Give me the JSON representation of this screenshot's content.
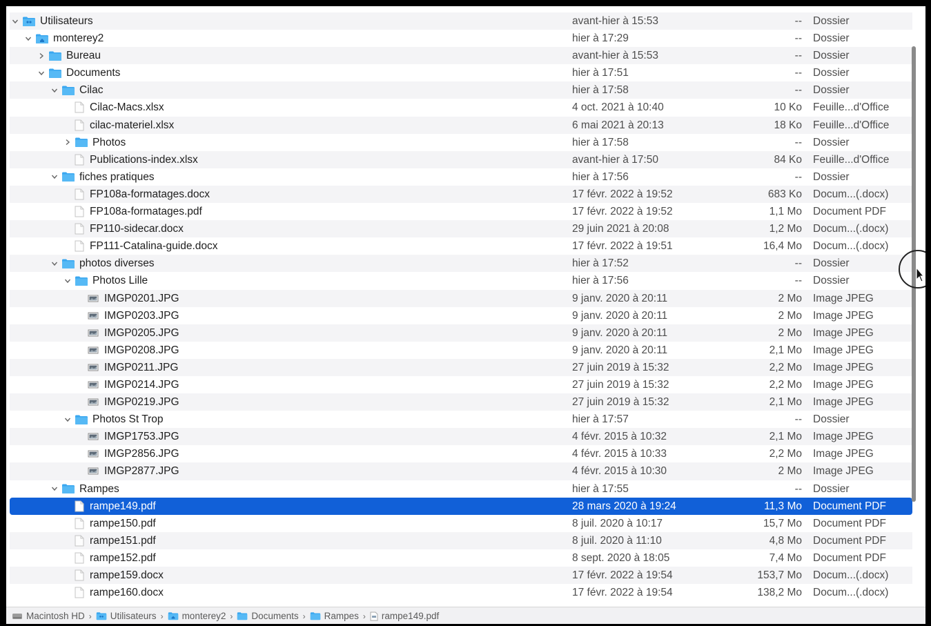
{
  "colors": {
    "folder": "#3aa7f0",
    "selection": "#1160d8",
    "stripe": "#f4f4f6"
  },
  "rows": [
    {
      "name": "Utilisateurs",
      "date": "avant-hier à 15:53",
      "size": "--",
      "kind": "Dossier",
      "indent": 0,
      "type": "folder",
      "chev": "down",
      "special": "users"
    },
    {
      "name": "monterey2",
      "date": "hier à 17:29",
      "size": "--",
      "kind": "Dossier",
      "indent": 1,
      "type": "folder",
      "chev": "down",
      "special": "home"
    },
    {
      "name": "Bureau",
      "date": "avant-hier à 15:53",
      "size": "--",
      "kind": "Dossier",
      "indent": 2,
      "type": "folder",
      "chev": "right"
    },
    {
      "name": "Documents",
      "date": "hier à 17:51",
      "size": "--",
      "kind": "Dossier",
      "indent": 2,
      "type": "folder",
      "chev": "down"
    },
    {
      "name": "Cilac",
      "date": "hier à 17:58",
      "size": "--",
      "kind": "Dossier",
      "indent": 3,
      "type": "folder",
      "chev": "down"
    },
    {
      "name": "Cilac-Macs.xlsx",
      "date": "4 oct. 2021 à 10:40",
      "size": "10 Ko",
      "kind": "Feuille...d'Office",
      "indent": 4,
      "type": "file"
    },
    {
      "name": "cilac-materiel.xlsx",
      "date": "6 mai 2021 à 20:13",
      "size": "18 Ko",
      "kind": "Feuille...d'Office",
      "indent": 4,
      "type": "file"
    },
    {
      "name": "Photos",
      "date": "hier à 17:58",
      "size": "--",
      "kind": "Dossier",
      "indent": 4,
      "type": "folder",
      "chev": "right"
    },
    {
      "name": "Publications-index.xlsx",
      "date": "avant-hier à 17:50",
      "size": "84 Ko",
      "kind": "Feuille...d'Office",
      "indent": 4,
      "type": "file"
    },
    {
      "name": "fiches pratiques",
      "date": "hier à 17:56",
      "size": "--",
      "kind": "Dossier",
      "indent": 3,
      "type": "folder",
      "chev": "down"
    },
    {
      "name": "FP108a-formatages.docx",
      "date": "17 févr. 2022 à 19:52",
      "size": "683 Ko",
      "kind": "Docum...(.docx)",
      "indent": 4,
      "type": "file"
    },
    {
      "name": "FP108a-formatages.pdf",
      "date": "17 févr. 2022 à 19:52",
      "size": "1,1 Mo",
      "kind": "Document PDF",
      "indent": 4,
      "type": "file"
    },
    {
      "name": "FP110-sidecar.docx",
      "date": "29 juin 2021 à 20:08",
      "size": "1,2 Mo",
      "kind": "Docum...(.docx)",
      "indent": 4,
      "type": "file"
    },
    {
      "name": "FP111-Catalina-guide.docx",
      "date": "17 févr. 2022 à 19:51",
      "size": "16,4 Mo",
      "kind": "Docum...(.docx)",
      "indent": 4,
      "type": "file"
    },
    {
      "name": "photos diverses",
      "date": "hier à 17:52",
      "size": "--",
      "kind": "Dossier",
      "indent": 3,
      "type": "folder",
      "chev": "down"
    },
    {
      "name": "Photos Lille",
      "date": "hier à 17:56",
      "size": "--",
      "kind": "Dossier",
      "indent": 4,
      "type": "folder",
      "chev": "down"
    },
    {
      "name": "IMGP0201.JPG",
      "date": "9 janv. 2020 à 20:11",
      "size": "2 Mo",
      "kind": "Image JPEG",
      "indent": 5,
      "type": "image"
    },
    {
      "name": "IMGP0203.JPG",
      "date": "9 janv. 2020 à 20:11",
      "size": "2 Mo",
      "kind": "Image JPEG",
      "indent": 5,
      "type": "image"
    },
    {
      "name": "IMGP0205.JPG",
      "date": "9 janv. 2020 à 20:11",
      "size": "2 Mo",
      "kind": "Image JPEG",
      "indent": 5,
      "type": "image"
    },
    {
      "name": "IMGP0208.JPG",
      "date": "9 janv. 2020 à 20:11",
      "size": "2,1 Mo",
      "kind": "Image JPEG",
      "indent": 5,
      "type": "image"
    },
    {
      "name": "IMGP0211.JPG",
      "date": "27 juin 2019 à 15:32",
      "size": "2,2 Mo",
      "kind": "Image JPEG",
      "indent": 5,
      "type": "image"
    },
    {
      "name": "IMGP0214.JPG",
      "date": "27 juin 2019 à 15:32",
      "size": "2,2 Mo",
      "kind": "Image JPEG",
      "indent": 5,
      "type": "image"
    },
    {
      "name": "IMGP0219.JPG",
      "date": "27 juin 2019 à 15:32",
      "size": "2,1 Mo",
      "kind": "Image JPEG",
      "indent": 5,
      "type": "image"
    },
    {
      "name": "Photos St Trop",
      "date": "hier à 17:57",
      "size": "--",
      "kind": "Dossier",
      "indent": 4,
      "type": "folder",
      "chev": "down"
    },
    {
      "name": "IMGP1753.JPG",
      "date": "4 févr. 2015 à 10:32",
      "size": "2,1 Mo",
      "kind": "Image JPEG",
      "indent": 5,
      "type": "image"
    },
    {
      "name": "IMGP2856.JPG",
      "date": "4 févr. 2015 à 10:33",
      "size": "2,2 Mo",
      "kind": "Image JPEG",
      "indent": 5,
      "type": "image"
    },
    {
      "name": "IMGP2877.JPG",
      "date": "4 févr. 2015 à 10:30",
      "size": "2 Mo",
      "kind": "Image JPEG",
      "indent": 5,
      "type": "image"
    },
    {
      "name": "Rampes",
      "date": "hier à 17:55",
      "size": "--",
      "kind": "Dossier",
      "indent": 3,
      "type": "folder",
      "chev": "down"
    },
    {
      "name": "rampe149.pdf",
      "date": "28 mars 2020 à 19:24",
      "size": "11,3 Mo",
      "kind": "Document PDF",
      "indent": 4,
      "type": "file",
      "selected": true
    },
    {
      "name": "rampe150.pdf",
      "date": "8 juil. 2020 à 10:17",
      "size": "15,7 Mo",
      "kind": "Document PDF",
      "indent": 4,
      "type": "file"
    },
    {
      "name": "rampe151.pdf",
      "date": "8 juil. 2020 à 11:10",
      "size": "4,8 Mo",
      "kind": "Document PDF",
      "indent": 4,
      "type": "file"
    },
    {
      "name": "rampe152.pdf",
      "date": "8 sept. 2020 à 18:05",
      "size": "7,4 Mo",
      "kind": "Document PDF",
      "indent": 4,
      "type": "file"
    },
    {
      "name": "rampe159.docx",
      "date": "17 févr. 2022 à 19:54",
      "size": "153,7 Mo",
      "kind": "Docum...(.docx)",
      "indent": 4,
      "type": "file"
    },
    {
      "name": "rampe160.docx",
      "date": "17 févr. 2022 à 19:54",
      "size": "138,2 Mo",
      "kind": "Docum...(.docx)",
      "indent": 4,
      "type": "file"
    }
  ],
  "pathbar": [
    {
      "label": "Macintosh HD",
      "icon": "disk-icon"
    },
    {
      "label": "Utilisateurs",
      "icon": "folder-icon"
    },
    {
      "label": "monterey2",
      "icon": "home-folder-icon"
    },
    {
      "label": "Documents",
      "icon": "folder-icon"
    },
    {
      "label": "Rampes",
      "icon": "folder-icon"
    },
    {
      "label": "rampe149.pdf",
      "icon": "pdf-file-icon"
    }
  ]
}
